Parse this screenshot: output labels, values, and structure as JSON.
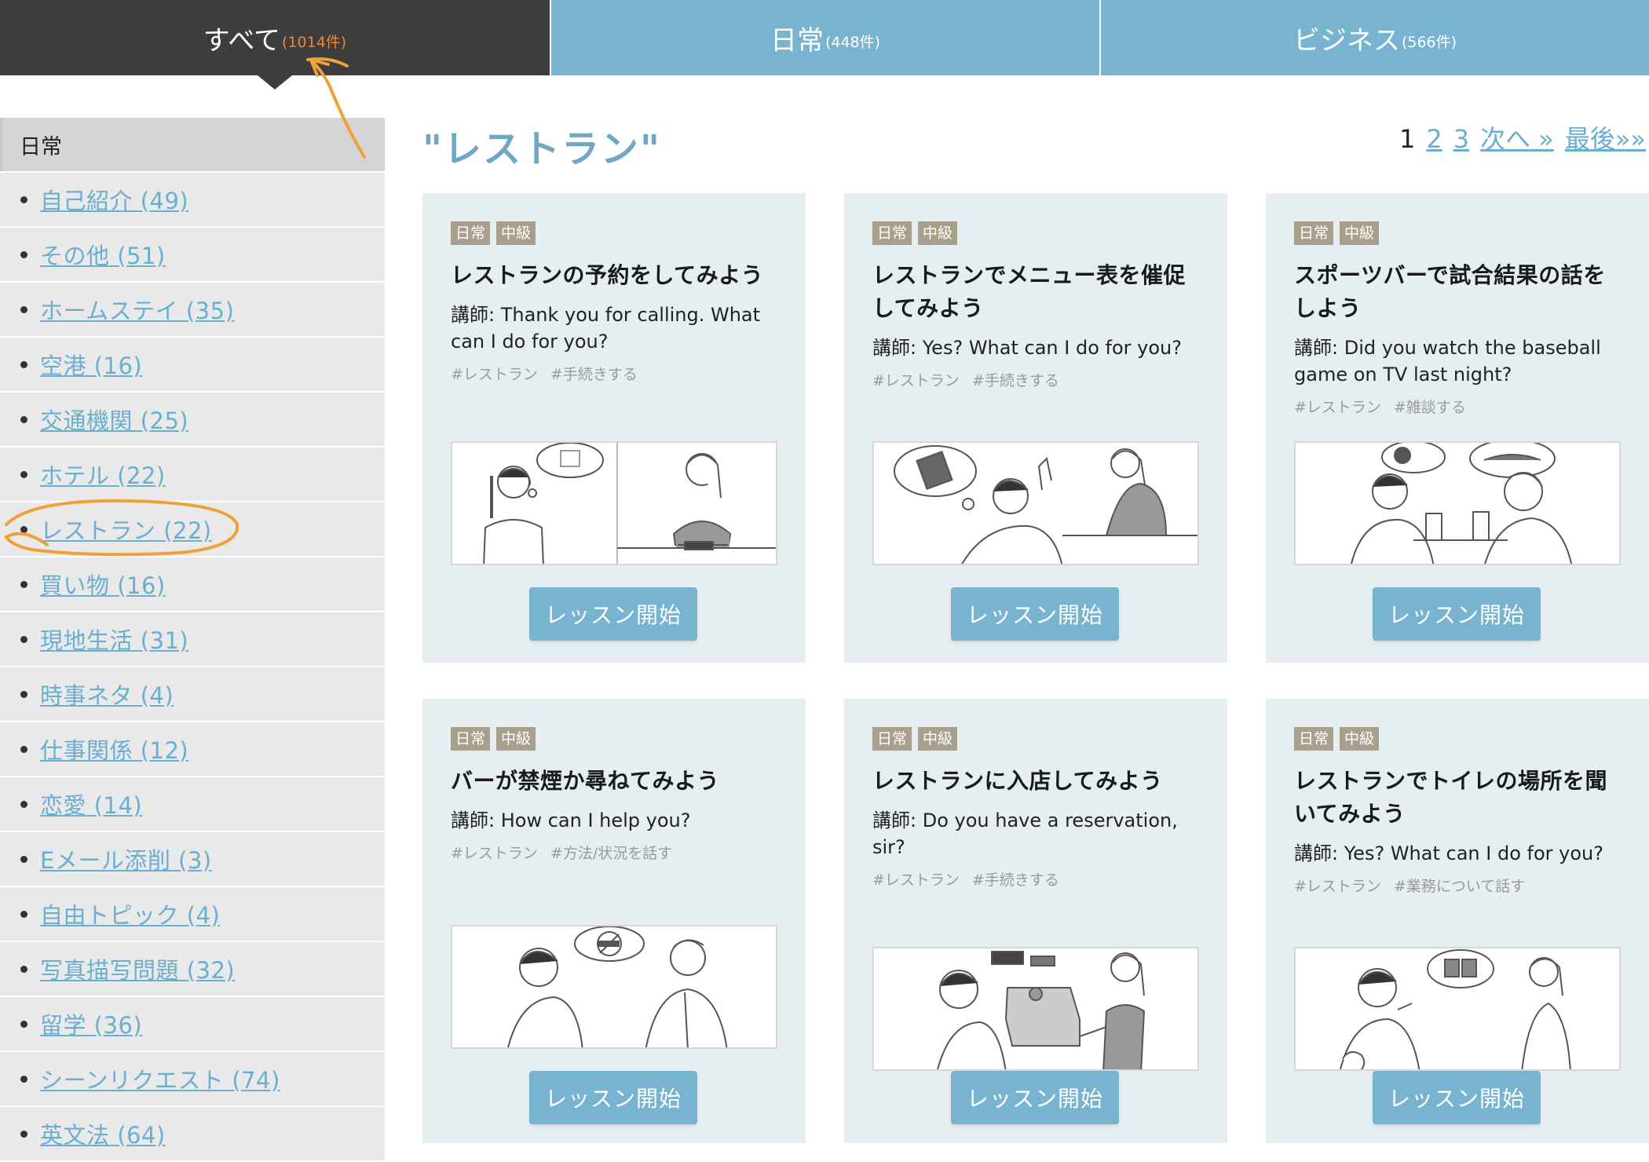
{
  "tabs": [
    {
      "label": "すべて",
      "count": "(1014件)"
    },
    {
      "label": "日常",
      "count": "(448件)"
    },
    {
      "label": "ビジネス",
      "count": "(566件)"
    }
  ],
  "sidebar": {
    "header": "日常",
    "items": [
      {
        "label": "自己紹介 (49)"
      },
      {
        "label": "その他 (51)"
      },
      {
        "label": "ホームステイ (35)"
      },
      {
        "label": "空港 (16)"
      },
      {
        "label": "交通機関 (25)"
      },
      {
        "label": "ホテル (22)"
      },
      {
        "label": "レストラン (22)"
      },
      {
        "label": "買い物 (16)"
      },
      {
        "label": "現地生活 (31)"
      },
      {
        "label": "時事ネタ (4)"
      },
      {
        "label": "仕事関係 (12)"
      },
      {
        "label": "恋愛 (14)"
      },
      {
        "label": "Eメール添削 (3)"
      },
      {
        "label": "自由トピック (4)"
      },
      {
        "label": "写真描写問題 (32)"
      },
      {
        "label": "留学 (36)"
      },
      {
        "label": "シーンリクエスト (74)"
      },
      {
        "label": "英文法 (64)"
      }
    ]
  },
  "main": {
    "title": "\"レストラン\"",
    "pagination": {
      "current": "1",
      "pages": [
        "2",
        "3"
      ],
      "next": "次へ »",
      "last": "最後»»"
    }
  },
  "cards": [
    {
      "badge1": "日常",
      "badge2": "中級",
      "title": "レストランの予約をしてみよう",
      "text": "講師: Thank you for calling. What can I do for you?",
      "tag1": "#レストラン",
      "tag2": "#手続きする",
      "button": "レッスン開始"
    },
    {
      "badge1": "日常",
      "badge2": "中級",
      "title": "レストランでメニュー表を催促してみよう",
      "text": "講師: Yes? What can I do for you?",
      "tag1": "#レストラン",
      "tag2": "#手続きする",
      "button": "レッスン開始"
    },
    {
      "badge1": "日常",
      "badge2": "中級",
      "title": "スポーツバーで試合結果の話をしよう",
      "text": "講師: Did you watch the baseball game on TV last night?",
      "tag1": "#レストラン",
      "tag2": "#雑談する",
      "button": "レッスン開始"
    },
    {
      "badge1": "日常",
      "badge2": "中級",
      "title": "バーが禁煙か尋ねてみよう",
      "text": "講師: How can I help you?",
      "tag1": "#レストラン",
      "tag2": "#方法/状況を話す",
      "button": "レッスン開始"
    },
    {
      "badge1": "日常",
      "badge2": "中級",
      "title": "レストランに入店してみよう",
      "text": "講師: Do you have a reservation, sir?",
      "tag1": "#レストラン",
      "tag2": "#手続きする",
      "button": "レッスン開始"
    },
    {
      "badge1": "日常",
      "badge2": "中級",
      "title": "レストランでトイレの場所を聞いてみよう",
      "text": "講師: Yes? What can I do for you?",
      "tag1": "#レストラン",
      "tag2": "#業務について話す",
      "button": "レッスン開始"
    }
  ],
  "colors": {
    "tab_active": "#3d3d3d",
    "tab_inactive": "#78b4cf",
    "accent_count": "#e9883a",
    "link": "#6aaed0",
    "card_bg": "#e5eef1",
    "badge_bg": "#a89f8d",
    "annotation": "#f0a038"
  }
}
